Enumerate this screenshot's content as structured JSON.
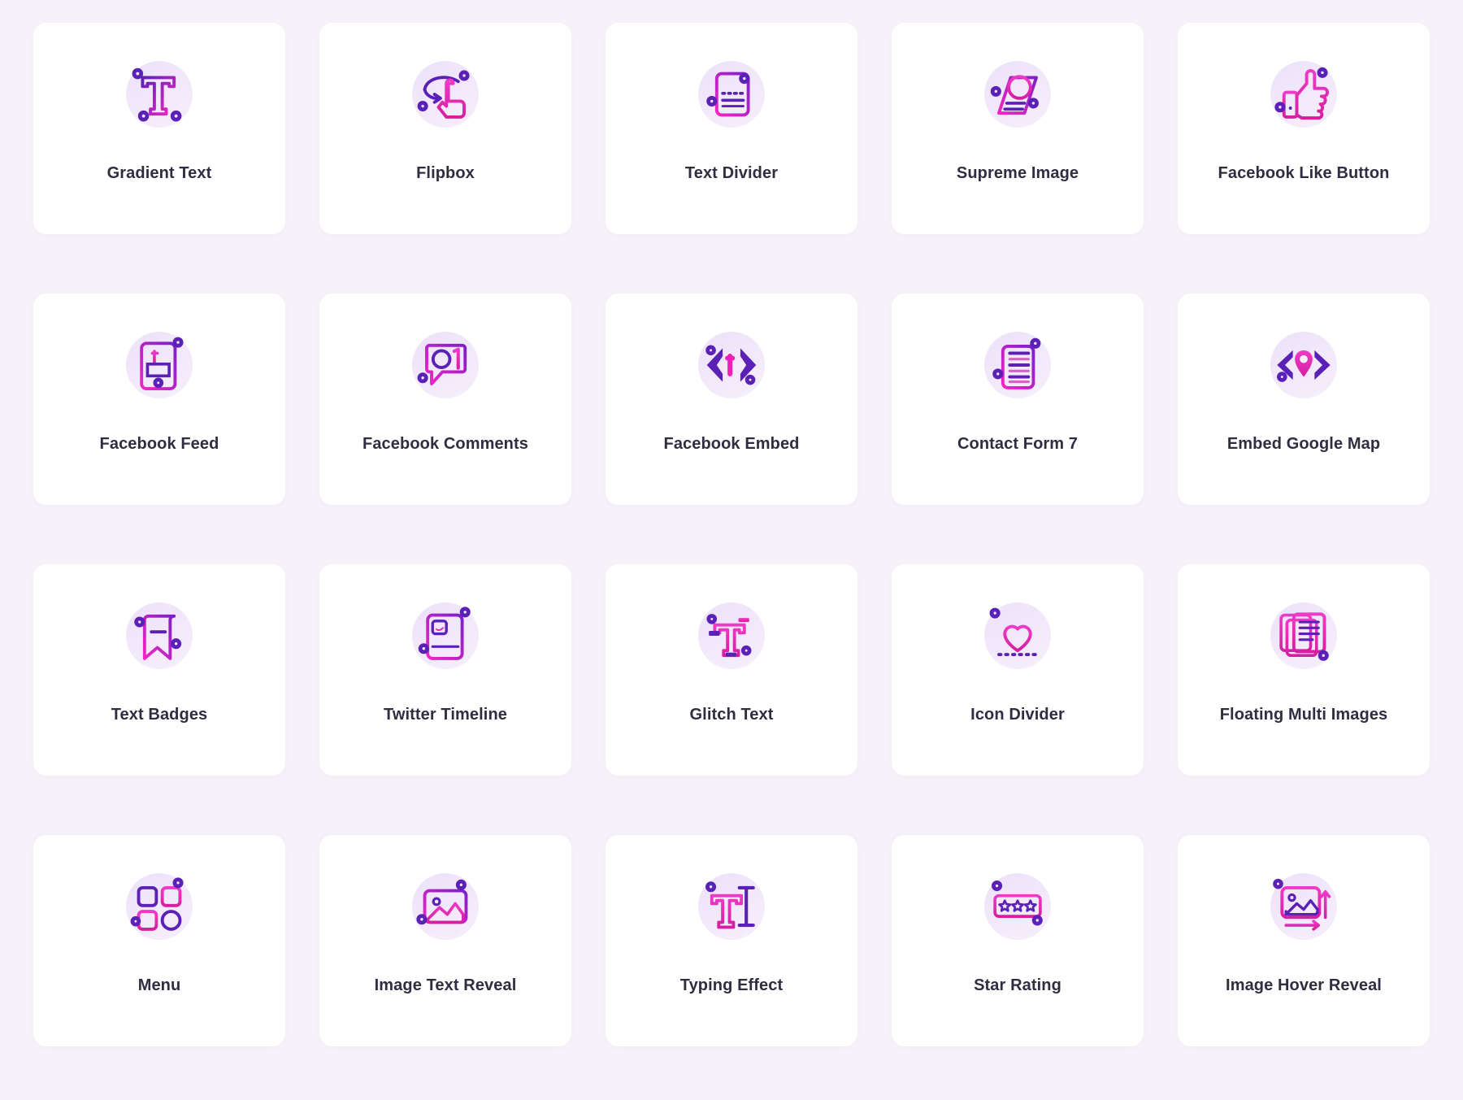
{
  "page": {
    "background_color": "#f7f2f9",
    "card_color": "#ffffff",
    "label_color": "#2f2e41",
    "accent_pink": "#ee2ec0",
    "accent_magenta": "#e0269f",
    "accent_purple": "#5b21b6",
    "accent_violet": "#6d28d9",
    "icon_blob_color": "#ece2fa"
  },
  "grid": {
    "columns": 5,
    "rows": 4,
    "items": [
      {
        "label": "Gradient Text",
        "icon": "gradient-text-icon"
      },
      {
        "label": "Flipbox",
        "icon": "flipbox-icon"
      },
      {
        "label": "Text Divider",
        "icon": "text-divider-icon"
      },
      {
        "label": "Supreme Image",
        "icon": "supreme-image-icon"
      },
      {
        "label": "Facebook Like Button",
        "icon": "thumbs-up-icon"
      },
      {
        "label": "Facebook Feed",
        "icon": "facebook-feed-icon"
      },
      {
        "label": "Facebook Comments",
        "icon": "comment-bubble-icon"
      },
      {
        "label": "Facebook Embed",
        "icon": "code-facebook-icon"
      },
      {
        "label": "Contact Form 7",
        "icon": "form-document-icon"
      },
      {
        "label": "Embed Google Map",
        "icon": "code-map-pin-icon"
      },
      {
        "label": "Text Badges",
        "icon": "bookmark-badge-icon"
      },
      {
        "label": "Twitter Timeline",
        "icon": "twitter-timeline-icon"
      },
      {
        "label": "Glitch Text",
        "icon": "glitch-text-icon"
      },
      {
        "label": "Icon Divider",
        "icon": "heart-divider-icon"
      },
      {
        "label": "Floating Multi Images",
        "icon": "multi-images-icon"
      },
      {
        "label": "Menu",
        "icon": "menu-grid-icon"
      },
      {
        "label": "Image Text Reveal",
        "icon": "image-reveal-icon"
      },
      {
        "label": "Typing Effect",
        "icon": "typing-effect-icon"
      },
      {
        "label": "Star Rating",
        "icon": "star-rating-icon"
      },
      {
        "label": "Image Hover Reveal",
        "icon": "image-hover-icon"
      }
    ]
  }
}
